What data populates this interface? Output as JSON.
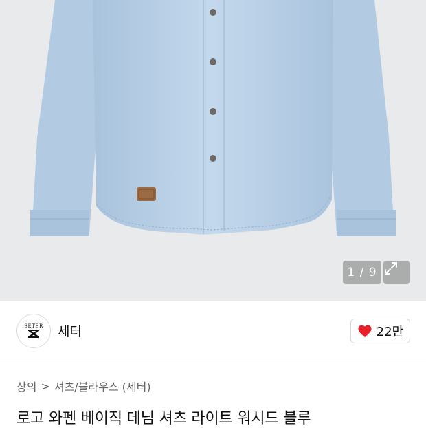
{
  "gallery": {
    "counter": "1 / 9",
    "icons": {
      "expand": "expand-icon"
    }
  },
  "brand": {
    "logo_text_top": "SETER",
    "name": "세터"
  },
  "like": {
    "icon": "heart-icon",
    "color": "#e8202a",
    "count": "22만"
  },
  "breadcrumb": {
    "level1": "상의",
    "separator": ">",
    "level2": "셔츠/블라우스 (세터)"
  },
  "product": {
    "title": "로고 와펜 베이직 데님 셔츠 라이트 워시드 블루"
  },
  "colors": {
    "denim": "#b9d0e6",
    "background": "#e9eaec"
  }
}
